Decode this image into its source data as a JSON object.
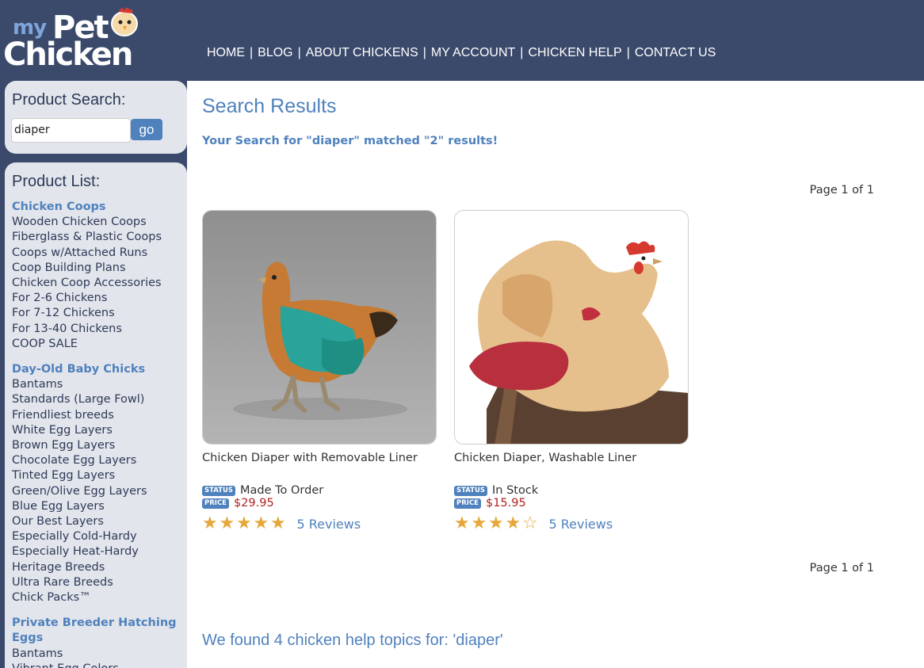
{
  "logo": {
    "my": "my",
    "pet": "Pet",
    "chicken": "Chicken"
  },
  "nav": [
    "HOME",
    "BLOG",
    "ABOUT CHICKENS",
    "MY ACCOUNT",
    "CHICKEN HELP",
    "CONTACT US"
  ],
  "search": {
    "title": "Product Search:",
    "value": "diaper",
    "go_label": "go"
  },
  "product_list": {
    "title": "Product List:",
    "groups": [
      {
        "category": "Chicken Coops",
        "items": [
          "Wooden Chicken Coops",
          "Fiberglass & Plastic Coops",
          "Coops w/Attached Runs",
          "Coop Building Plans",
          "Chicken Coop Accessories",
          "For 2-6 Chickens",
          "For 7-12 Chickens",
          "For 13-40 Chickens",
          "COOP SALE"
        ]
      },
      {
        "category": "Day-Old Baby Chicks",
        "items": [
          "Bantams",
          "Standards (Large Fowl)",
          "Friendliest breeds",
          "White Egg Layers",
          "Brown Egg Layers",
          "Chocolate Egg Layers",
          "Tinted Egg Layers",
          "Green/Olive Egg Layers",
          "Blue Egg Layers",
          "Our Best Layers",
          "Especially Cold-Hardy",
          "Especially Heat-Hardy",
          "Heritage Breeds",
          "Ultra Rare Breeds",
          "Chick Packs™"
        ]
      },
      {
        "category": "Private Breeder Hatching Eggs",
        "items": [
          "Bantams",
          "Vibrant Egg Colors"
        ]
      }
    ]
  },
  "main": {
    "title": "Search Results",
    "matched_text": "Your Search for \"diaper\" matched \"2\" results!",
    "pager_top": "Page 1 of 1",
    "pager_bottom": "Page 1 of 1",
    "help_title": "We found 4 chicken help topics for: 'diaper'"
  },
  "products": [
    {
      "name": "Chicken Diaper with Removable Liner",
      "status_badge": "STATUS",
      "status": "Made To Order",
      "price_badge": "PRICE",
      "price": "$29.95",
      "rating": 5,
      "reviews": "5 Reviews"
    },
    {
      "name": "Chicken Diaper, Washable Liner",
      "status_badge": "STATUS",
      "status": "In Stock",
      "price_badge": "PRICE",
      "price": "$15.95",
      "rating": 4,
      "reviews": "5 Reviews"
    }
  ],
  "colors": {
    "header_bg": "#3b4a6b",
    "accent": "#4f81bd",
    "price": "#b22222",
    "star": "#e6a83a",
    "sidebar_box": "#e3e5ec"
  }
}
